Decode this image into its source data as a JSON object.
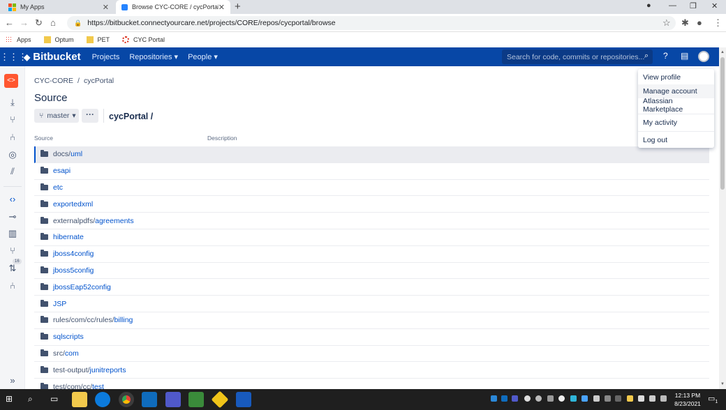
{
  "browser": {
    "tabs": [
      {
        "title": "My Apps",
        "close": "✕"
      },
      {
        "title": "Browse CYC-CORE / cycPortal - B",
        "close": "✕"
      }
    ],
    "new_tab": "+",
    "url": "https://bitbucket.connectyourcare.net/projects/CORE/repos/cycportal/browse",
    "bookmarks": [
      {
        "label": "Apps",
        "color": "#4285f4"
      },
      {
        "label": "Optum",
        "color": "#f2c94c"
      },
      {
        "label": "PET",
        "color": "#f2c94c"
      },
      {
        "label": "CYC Portal",
        "color": "#d9230f"
      }
    ]
  },
  "header": {
    "product": "Bitbucket",
    "nav": [
      {
        "label": "Projects",
        "caret": ""
      },
      {
        "label": "Repositories",
        "caret": "▾"
      },
      {
        "label": "People",
        "caret": "▾"
      }
    ],
    "search_placeholder": "Search for code, commits or repositories...",
    "brand_color": "#0747a6"
  },
  "breadcrumb": {
    "project": "CYC-CORE",
    "separator": "/",
    "repo": "cycPortal"
  },
  "page_title": "Source",
  "branch": {
    "label": "master",
    "caret": "▾",
    "more": "···"
  },
  "path": "cycPortal /",
  "table": {
    "columns": [
      "Source",
      "Description"
    ],
    "rows": [
      {
        "prefix": "docs/",
        "link": "uml"
      },
      {
        "prefix": "",
        "link": "esapi"
      },
      {
        "prefix": "",
        "link": "etc"
      },
      {
        "prefix": "",
        "link": "exportedxml"
      },
      {
        "prefix": "externalpdfs/",
        "link": "agreements"
      },
      {
        "prefix": "",
        "link": "hibernate"
      },
      {
        "prefix": "",
        "link": "jboss4config"
      },
      {
        "prefix": "",
        "link": "jboss5config"
      },
      {
        "prefix": "",
        "link": "jbossEap52config"
      },
      {
        "prefix": "",
        "link": "JSP"
      },
      {
        "prefix": "rules/com/cc/rules/",
        "link": "billing"
      },
      {
        "prefix": "",
        "link": "sqlscripts"
      },
      {
        "prefix": "src/",
        "link": "com"
      },
      {
        "prefix": "test-output/",
        "link": "junitreports"
      },
      {
        "prefix": "test/com/cc/",
        "link": "test"
      }
    ]
  },
  "sidebar": {
    "pr_badge": "16",
    "project_icon": "<>"
  },
  "user_menu": {
    "items": [
      "View profile",
      "Manage account",
      "Atlassian Marketplace",
      "My activity",
      "Log out"
    ]
  },
  "taskbar": {
    "time": "12:13 PM",
    "date": "8/23/2021",
    "notifications": "1"
  }
}
